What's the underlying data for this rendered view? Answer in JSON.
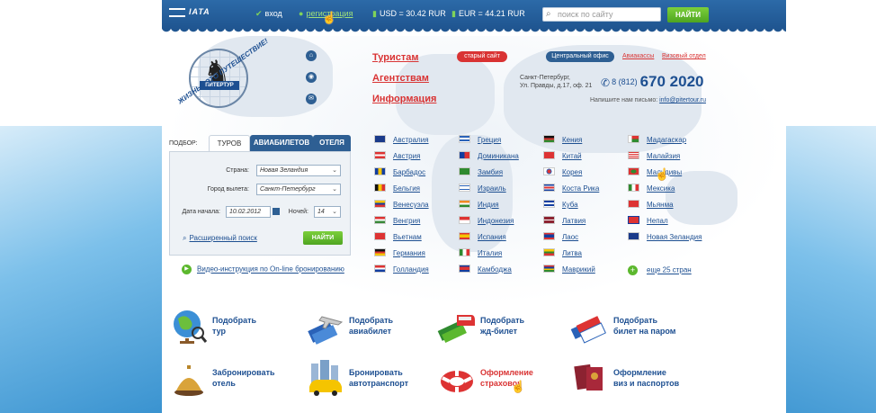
{
  "topbar": {
    "logo": "IATA",
    "login": "вход",
    "register": "регистрация",
    "usd": "USD = 30.42 RUR",
    "eur": "EUR = 44.21 RUR",
    "search_placeholder": "поиск по сайту",
    "search_button": "НАЙТИ"
  },
  "logo": {
    "brand": "ПИТЕРТУР",
    "slogan": "ЖИЗНЬ - ЭТО ПУТЕШЕСТВИЕ!"
  },
  "nav": {
    "tourists": "Туристам",
    "agencies": "Агентствам",
    "info": "Информация",
    "old_site": "старый сайт"
  },
  "office": {
    "tab": "Центральный офис",
    "link_avia": "Авиакассы",
    "link_visa": "Визовый отдел",
    "address_line1": "Санкт-Петербург,",
    "address_line2": "Ул. Правды, д.17, оф. 21",
    "phone_code": "8 (812)",
    "phone_number": "670 2020",
    "mail_prefix": "Напишите нам письмо:",
    "mail": "info@pitertour.ru"
  },
  "picker": {
    "label": "ПОДБОР:",
    "tabs": [
      "ТУРОВ",
      "АВИАБИЛЕТОВ",
      "ОТЕЛЯ"
    ],
    "country_label": "Страна:",
    "country_value": "Новая Зеландия",
    "city_label": "Город вылета:",
    "city_value": "Санкт-Петербург",
    "date_label": "Дата начала:",
    "date_value": "10.02.2012",
    "nights_label": "Ночей:",
    "nights_value": "14",
    "advanced": "Расширенный поиск",
    "find": "НАЙТИ"
  },
  "video_link": "Видео-инструкция по On-line бронированию",
  "countries": {
    "col1": [
      "Австралия",
      "Австрия",
      "Барбадос",
      "Бельгия",
      "Венесуэла",
      "Венгрия",
      "Вьетнам",
      "Германия",
      "Голландия"
    ],
    "col2": [
      "Греция",
      "Доминикана",
      "Замбия",
      "Израиль",
      "Индия",
      "Индонезия",
      "Испания",
      "Италия",
      "Камбоджа"
    ],
    "col3": [
      "Кения",
      "Китай",
      "Корея",
      "Коста Рика",
      "Куба",
      "Латвия",
      "Лаос",
      "Литва",
      "Маврикий"
    ],
    "col4": [
      "Мадагаскар",
      "Малайзия",
      "Мальдивы",
      "Мексика",
      "Мьянма",
      "Непал",
      "Новая Зеландия"
    ],
    "more": "еще 25 стран"
  },
  "services": [
    {
      "line1": "Подобрать",
      "line2": "тур"
    },
    {
      "line1": "Подобрать",
      "line2": "авиабилет"
    },
    {
      "line1": "Подобрать",
      "line2": "жд-билет"
    },
    {
      "line1": "Подобрать",
      "line2": "билет на паром"
    },
    {
      "line1": "Забронировать",
      "line2": "отель"
    },
    {
      "line1": "Бронировать",
      "line2": "автотранспорт"
    },
    {
      "line1": "Оформление",
      "line2": "страховок"
    },
    {
      "line1": "Оформление",
      "line2": "виз и паспортов"
    }
  ],
  "colors": {
    "brand_blue": "#1d4f91",
    "accent_red": "#d93333",
    "accent_green": "#5cb82e"
  }
}
